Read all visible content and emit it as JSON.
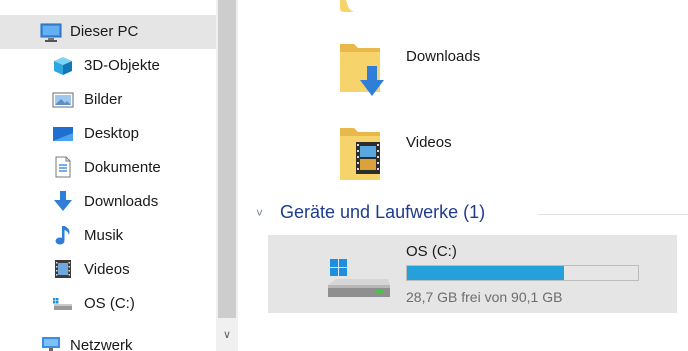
{
  "sidebar": {
    "items": [
      {
        "label": "Dieser PC",
        "icon": "pc-icon",
        "selected": true
      },
      {
        "label": "3D-Objekte",
        "icon": "cube-3d-icon"
      },
      {
        "label": "Bilder",
        "icon": "pictures-icon"
      },
      {
        "label": "Desktop",
        "icon": "desktop-icon"
      },
      {
        "label": "Dokumente",
        "icon": "document-icon"
      },
      {
        "label": "Downloads",
        "icon": "download-arrow-icon"
      },
      {
        "label": "Musik",
        "icon": "music-note-icon"
      },
      {
        "label": "Videos",
        "icon": "film-icon"
      },
      {
        "label": "OS (C:)",
        "icon": "drive-icon"
      },
      {
        "label": "Netzwerk",
        "icon": "network-icon"
      }
    ]
  },
  "content": {
    "folders": [
      {
        "label": "Downloads",
        "icon": "downloads-folder-icon"
      },
      {
        "label": "Videos",
        "icon": "videos-folder-icon"
      }
    ],
    "group": {
      "title": "Geräte und Laufwerke (1)",
      "chevron": "˅"
    },
    "drive": {
      "name": "OS (C:)",
      "free_text": "28,7 GB frei von 90,1 GB",
      "used_fraction": 0.68,
      "icon": "windows-drive-icon"
    }
  },
  "colors": {
    "selection": "#e5e5e5",
    "progress": "#26a0da",
    "group_title": "#1e3c8c",
    "folder_yellow": "#f6d46b",
    "accent_blue": "#2f7fd8"
  }
}
